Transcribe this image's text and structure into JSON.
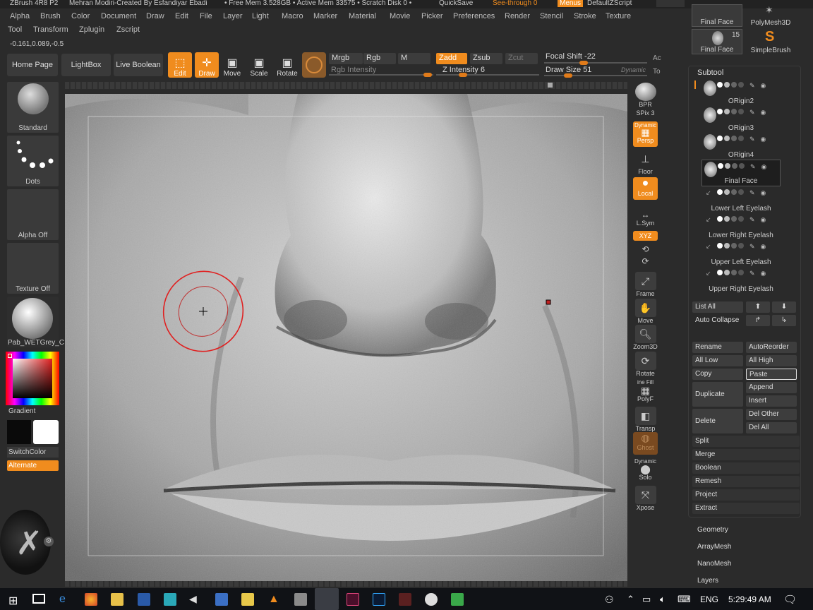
{
  "titlebar": {
    "app": "ZBrush 4R8 P2",
    "author": "Mehran Modiri-Created By Esfandiyar Ebadi",
    "free_mem": "• Free Mem 3.528GB • Active Mem 33575 • Scratch Disk 0 •",
    "quicksave": "QuickSave",
    "see_through": "See-through 0",
    "menus": "Menus",
    "script": "DefaultZScript"
  },
  "menu_row1": [
    "Alpha",
    "Brush",
    "Color",
    "Document",
    "Draw",
    "Edit",
    "File",
    "Layer",
    "Light",
    "Macro",
    "Marker",
    "Material",
    "Movie",
    "Picker",
    "Preferences",
    "Render",
    "Stencil",
    "Stroke",
    "Texture"
  ],
  "menu_row2": [
    "Tool",
    "Transform",
    "Zplugin",
    "Zscript"
  ],
  "coords": "-0.161,0.089,-0.5",
  "toolbar": {
    "home": "Home Page",
    "lightbox": "LightBox",
    "live_boolean": "Live Boolean",
    "edit": "Edit",
    "draw": "Draw",
    "move": "Move",
    "scale": "Scale",
    "rotate": "Rotate",
    "mrgb": "Mrgb",
    "rgb": "Rgb",
    "m": "M",
    "zadd": "Zadd",
    "zsub": "Zsub",
    "zcut": "Zcut",
    "rgb_intensity": "Rgb Intensity",
    "z_intensity_label": "Z Intensity",
    "z_intensity": "6",
    "focal_shift_label": "Focal Shift",
    "focal_shift": "-22",
    "draw_size_label": "Draw Size",
    "draw_size": "51",
    "dynamic": "Dynamic",
    "ac": "Ac",
    "to": "To"
  },
  "left_shelf": {
    "brush": "Standard",
    "stroke": "Dots",
    "alpha": "Alpha Off",
    "texture": "Texture Off",
    "material": "Pab_WETGrey_C",
    "gradient": "Gradient",
    "switch_color": "SwitchColor",
    "alternate": "Alternate"
  },
  "right_tools": {
    "bpr": "BPR",
    "spix_label": "SPix",
    "spix": "3",
    "dynamic": "Dynamic",
    "persp": "Persp",
    "floor": "Floor",
    "local": "Local",
    "lsym": "L.Sym",
    "xyz": "XYZ",
    "frame": "Frame",
    "move": "Move",
    "zoom3d": "Zoom3D",
    "rotate": "Rotate",
    "line_fill": "ine Fill",
    "polyf": "PolyF",
    "transp": "Transp",
    "ghost": "Ghost",
    "dynamic2": "Dynamic",
    "solo": "Solo",
    "xpose": "Xpose"
  },
  "tool_thumbs": {
    "t1": "Final Face",
    "t2": "PolyMesh3D",
    "t3": "Final Face",
    "t3_count": "15",
    "t4": "SimpleBrush"
  },
  "subtool": {
    "title": "Subtool",
    "items": [
      {
        "name": "ORigin2"
      },
      {
        "name": "ORigin3"
      },
      {
        "name": "ORigin4"
      },
      {
        "name": "Final Face"
      },
      {
        "name": "Lower Left Eyelash"
      },
      {
        "name": "Lower Right Eyelash"
      },
      {
        "name": "Upper Left Eyelash"
      },
      {
        "name": "Upper Right Eyelash"
      }
    ],
    "list_all": "List All",
    "auto_collapse": "Auto Collapse",
    "rename": "Rename",
    "auto_reorder": "AutoReorder",
    "all_low": "All Low",
    "all_high": "All High",
    "copy": "Copy",
    "paste": "Paste",
    "duplicate": "Duplicate",
    "append": "Append",
    "insert": "Insert",
    "delete": "Delete",
    "del_other": "Del Other",
    "del_all": "Del All",
    "split": "Split",
    "merge": "Merge",
    "boolean": "Boolean",
    "remesh": "Remesh",
    "project": "Project",
    "extract": "Extract"
  },
  "sections": [
    "Geometry",
    "ArrayMesh",
    "NanoMesh",
    "Layers"
  ],
  "taskbar": {
    "lang": "ENG",
    "time": "5:29:49 AM"
  },
  "colors": {
    "accent": "#f08c1e",
    "panel": "#3a3a3a",
    "bg": "#2b2b2b"
  }
}
